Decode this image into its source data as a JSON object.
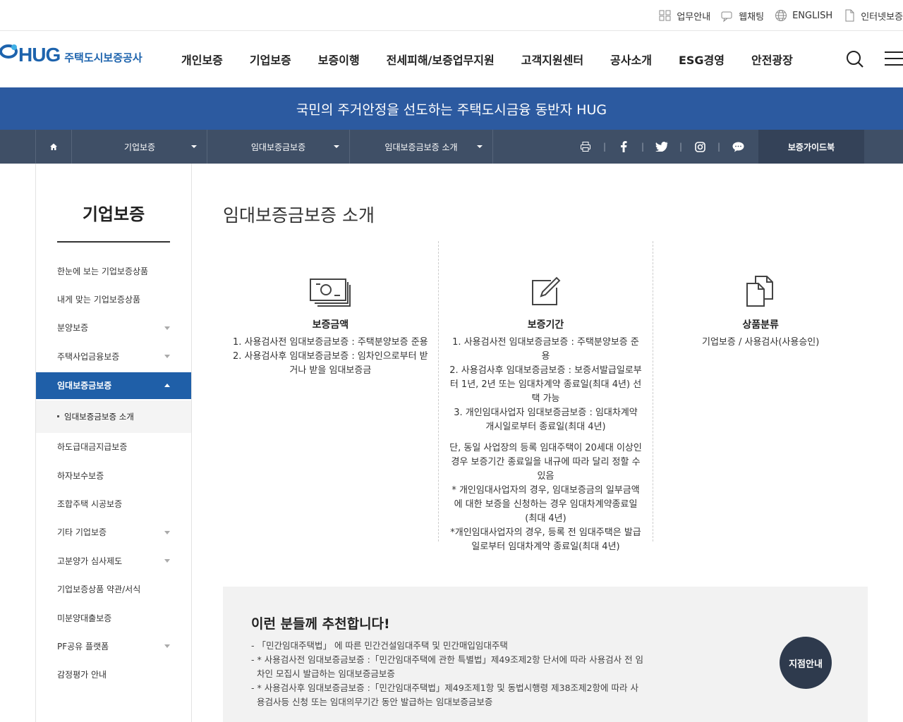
{
  "util": {
    "items": [
      {
        "label": "업무안내",
        "icon": "grid-icon"
      },
      {
        "label": "웹채팅",
        "icon": "chat-icon"
      },
      {
        "label": "ENGLISH",
        "icon": "globe-icon"
      },
      {
        "label": "인터넷보증",
        "icon": "document-icon"
      }
    ]
  },
  "header": {
    "logo_mark": "HUG",
    "logo_text": "주택도시보증공사",
    "nav": [
      "개인보증",
      "기업보증",
      "보증이행",
      "전세피해/보증업무지원",
      "고객지원센터",
      "공사소개",
      "ESG경영",
      "안전광장"
    ]
  },
  "banner": {
    "text": "국민의 주거안정을 선도하는 주택도시금융 동반자 HUG"
  },
  "location": {
    "level1": "기업보증",
    "level2": "임대보증금보증",
    "level3": "임대보증금보증 소개",
    "guide": "보증가이드북"
  },
  "sidebar": {
    "title": "기업보증",
    "items": [
      {
        "label": "한눈에 보는 기업보증상품"
      },
      {
        "label": "내게 맞는 기업보증상품"
      },
      {
        "label": "분양보증"
      },
      {
        "label": "주택사업금융보증"
      },
      {
        "label": "임대보증금보증"
      },
      {
        "label": "임대보증금보증 소개"
      },
      {
        "label": "하도급대금지급보증"
      },
      {
        "label": "하자보수보증"
      },
      {
        "label": "조합주택 시공보증"
      },
      {
        "label": "기타 기업보증"
      },
      {
        "label": "고분양가 심사제도"
      },
      {
        "label": "기업보증상품 약관/서식"
      },
      {
        "label": "미분양대출보증"
      },
      {
        "label": "PF공유 플랫폼"
      },
      {
        "label": "감정평가 안내"
      }
    ]
  },
  "main": {
    "title": "임대보증금보증 소개",
    "cols": [
      {
        "head": "보증금액",
        "lines": [
          "1. 사용검사전 임대보증금보증 : 주택분양보증 준용 2. 사용검사후 임대보증금보증 : 임차인으로부터 받거나 받을 임대보증금"
        ],
        "note": ""
      },
      {
        "head": "보증기간",
        "lines": [
          "1. 사용검사전 임대보증금보증 : 주택분양보증 준용",
          "2. 사용검사후 임대보증금보증 : 보증서발급일로부터 1년, 2년 또는 임대차계약 종료일(최대 4년) 선택 가능",
          "3. 개인임대사업자 임대보증금보증 : 임대차계약 개시일로부터 종료일(최대 4년)"
        ],
        "note_lines": [
          "단, 동일 사업장의 등록 임대주택이 20세대 이상인 경우 보증기간 종료일을 내규에 따라 달리 정할 수 있음",
          "* 개인임대사업자의 경우, 임대보증금의 일부금액에 대한 보증을 신청하는 경우 임대차계약종료일(최대 4년)",
          "*개인임대사업자의 경우, 등록 전 임대주택은 발급일로부터 임대차계약 종료일(최대 4년)"
        ]
      },
      {
        "head": "상품분류",
        "lines": [
          "기업보증 / 사용검사(사용승인)"
        ],
        "note": ""
      }
    ]
  },
  "recommend": {
    "title": "이런 분들께 추천합니다!",
    "items": [
      "- 「민간임대주택법」 에 따른 민간건설임대주택 및 민간매입임대주택",
      "- * 사용검사전 임대보증금보증 :「민간임대주택에 관한 특별법」제49조제2항 단서에 따라 사용검사 전 임차인 모집시 발급하는 임대보증금보증",
      "- * 사용검사후 임대보증금보증 :「민간임대주택법」제49조제1항 및 동법시행령 제38조제2항에 따라 사용검사등 신청 또는 임대의무기간 동안 발급하는 임대보증금보증"
    ]
  },
  "branch_button": "지점안내",
  "colors": {
    "brand": "#1d63ad",
    "banner": "#2c5aa0",
    "locbar": "#3f4f66",
    "active": "#1f5fa8"
  }
}
